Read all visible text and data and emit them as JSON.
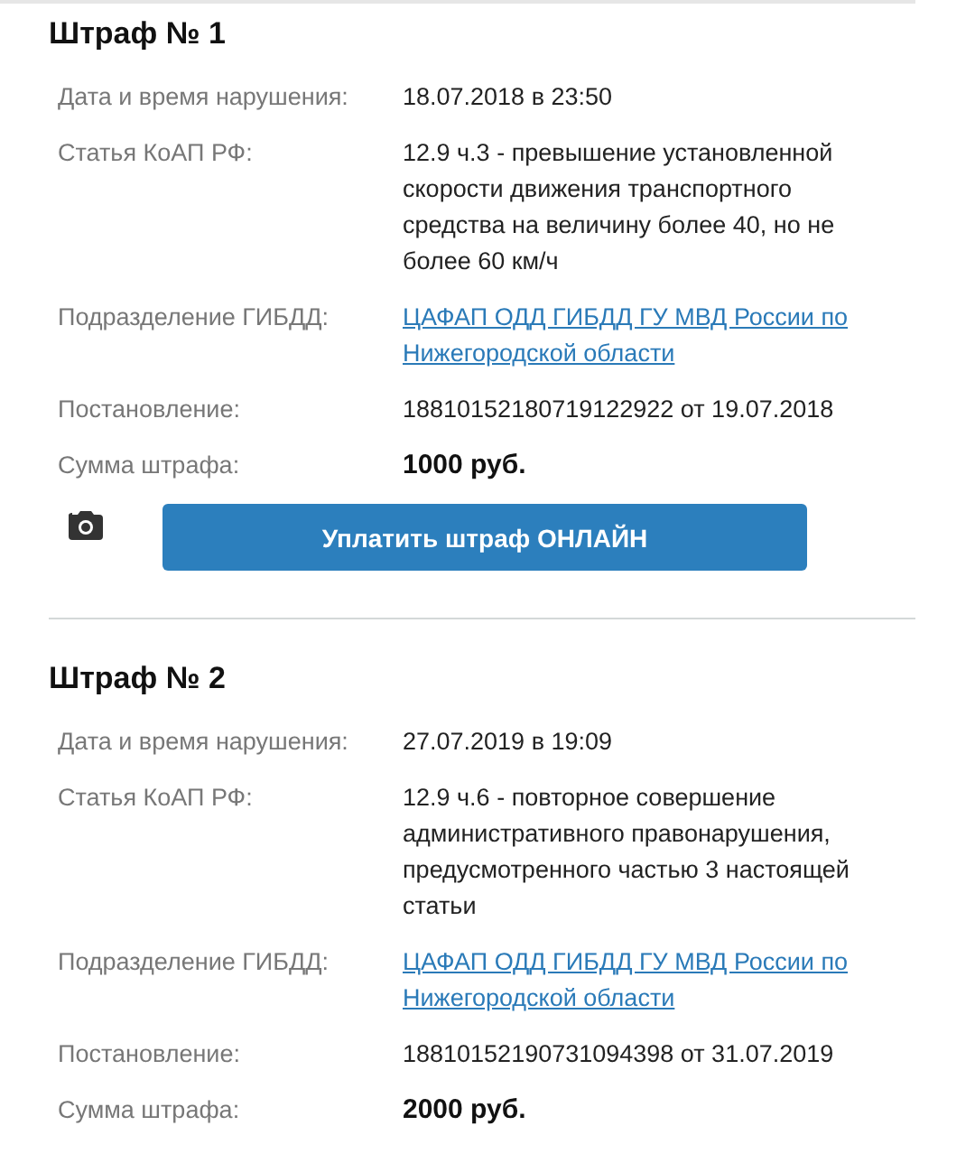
{
  "fines": [
    {
      "title": "Штраф № 1",
      "rows": [
        {
          "kind": "text",
          "label": "Дата и время нарушения:",
          "value": "18.07.2018 в 23:50"
        },
        {
          "kind": "text",
          "label": "Статья КоАП РФ:",
          "value": "12.9 ч.3 - превышение установленной скорости движения транспортного средства на величину более 40, но не более 60 км/ч"
        },
        {
          "kind": "link",
          "label": "Подразделение ГИБДД:",
          "value": "ЦАФАП ОДД ГИБДД ГУ МВД России по Нижегородской области"
        },
        {
          "kind": "text",
          "label": "Постановление:",
          "value": "18810152180719122922 от 19.07.2018"
        },
        {
          "kind": "amount",
          "label": "Сумма штрафа:",
          "value": "1000 руб."
        }
      ],
      "pay_button": "Уплатить штраф ОНЛАЙН",
      "has_photo": true
    },
    {
      "title": "Штраф № 2",
      "rows": [
        {
          "kind": "text",
          "label": "Дата и время нарушения:",
          "value": "27.07.2019 в 19:09"
        },
        {
          "kind": "text",
          "label": "Статья КоАП РФ:",
          "value": "12.9 ч.6 - повторное совершение административного правонарушения, предусмотренного частью 3 настоящей статьи"
        },
        {
          "kind": "link",
          "label": "Подразделение ГИБДД:",
          "value": "ЦАФАП ОДД ГИБДД ГУ МВД России по Нижегородской области"
        },
        {
          "kind": "text",
          "label": "Постановление:",
          "value": "18810152190731094398 от 31.07.2019"
        },
        {
          "kind": "amount",
          "label": "Сумма штрафа:",
          "value": "2000 руб."
        }
      ]
    }
  ]
}
